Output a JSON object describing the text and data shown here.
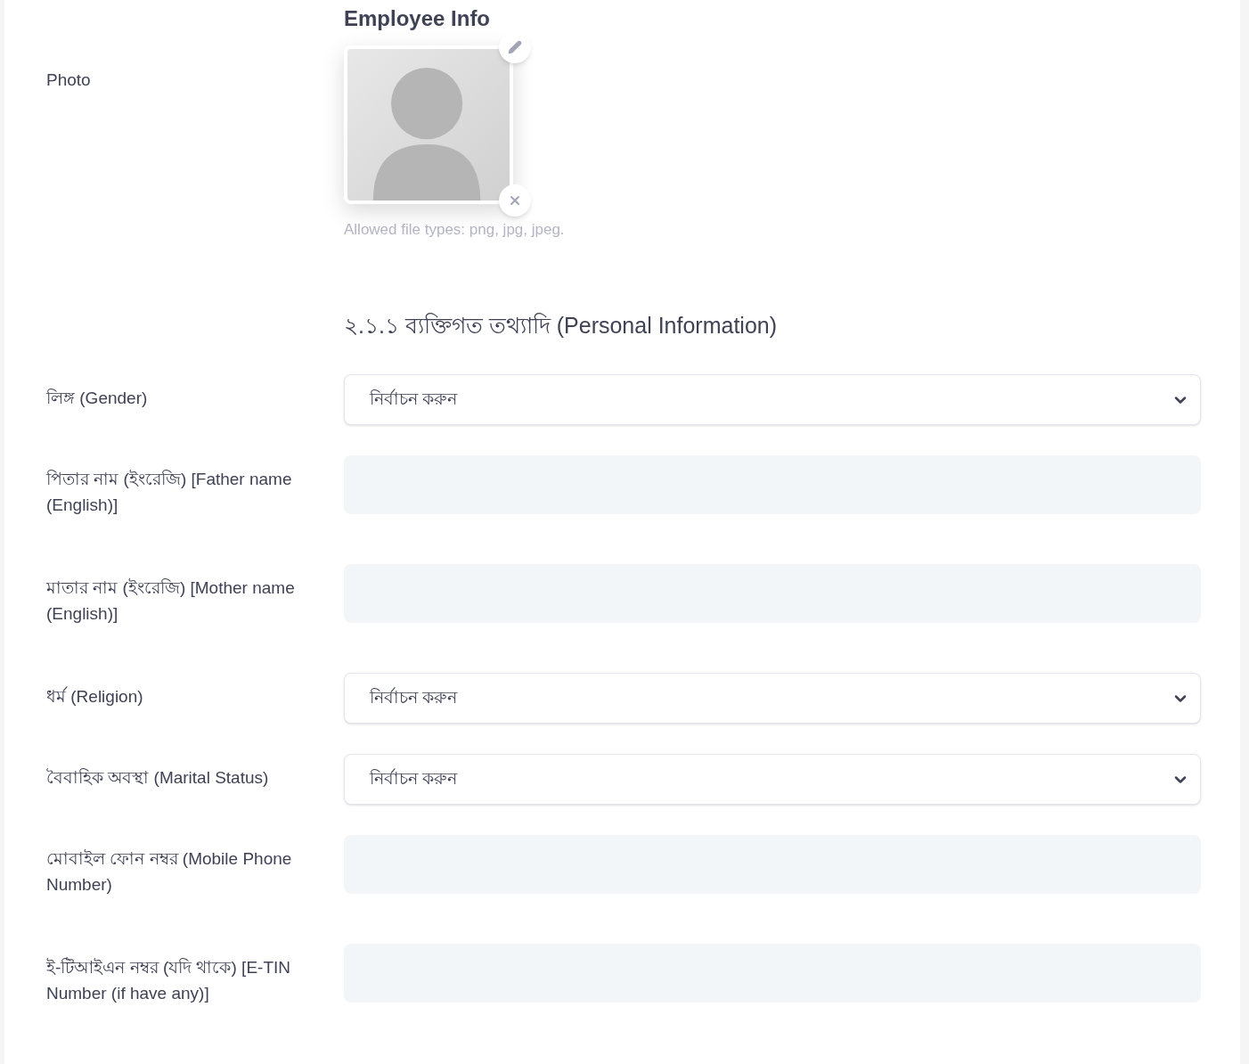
{
  "section_title": "Employee Info",
  "photo": {
    "label": "Photo",
    "hint": "Allowed file types: png, jpg, jpeg."
  },
  "subsection_title": "২.১.১ ব্যক্তিগত তথ্যাদি (Personal Information)",
  "fields": [
    {
      "kind": "select",
      "label": "লিঙ্গ (Gender)",
      "value": "নির্বাচন করুন"
    },
    {
      "kind": "text",
      "label": "পিতার নাম (ইংরেজি) [Father name (English)]"
    },
    {
      "kind": "text",
      "label": "মাতার নাম (ইংরেজি) [Mother name (English)]"
    },
    {
      "kind": "select",
      "label": "ধর্ম (Religion)",
      "value": "নির্বাচন করুন"
    },
    {
      "kind": "select",
      "label": "বৈবাহিক অবস্থা (Marital Status)",
      "value": "নির্বাচন করুন"
    },
    {
      "kind": "text",
      "label": "মোবাইল ফোন নম্বর (Mobile Phone Number)"
    },
    {
      "kind": "text",
      "label": "ই-টিআইএন নম্বর (যদি থাকে) [E-TIN Number (if have any)]"
    }
  ]
}
